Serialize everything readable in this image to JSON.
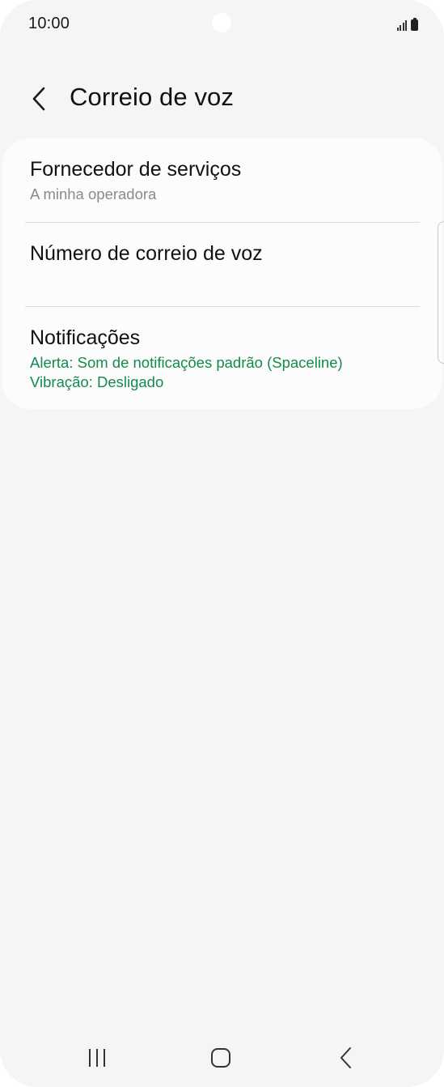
{
  "status_bar": {
    "time": "10:00",
    "icons": [
      "signal-icon",
      "battery-icon"
    ]
  },
  "header": {
    "back_icon": "chevron-left-icon",
    "title": "Correio de voz"
  },
  "settings": {
    "items": [
      {
        "title": "Fornecedor de serviços",
        "subtitle": "A minha operadora"
      },
      {
        "title": "Número de correio de voz"
      },
      {
        "title": "Notificações",
        "subtitle_lines": [
          "Alerta: Som de notificações padrão (Spaceline)",
          "Vibração: Desligado"
        ]
      }
    ]
  },
  "nav_bar": {
    "buttons": [
      "recent-apps-icon",
      "home-icon",
      "back-icon"
    ]
  },
  "colors": {
    "background": "#f5f5f5",
    "card": "#fcfcfc",
    "accent_green": "#138a4f",
    "secondary_text": "#8a8a8a"
  }
}
